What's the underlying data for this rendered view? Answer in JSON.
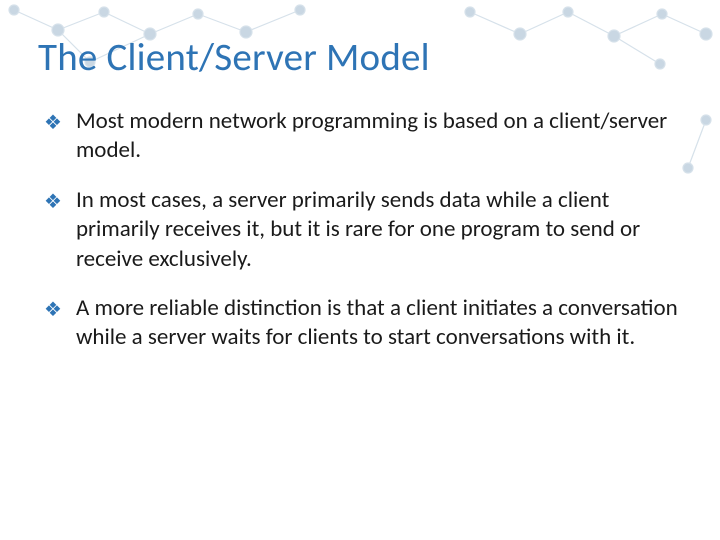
{
  "title": "The Client/Server Model",
  "bullets": [
    "Most modern network programming is based on a client/server model.",
    "In most cases, a server primarily sends data while a client primarily receives it, but it is rare for one program to send or receive exclusively.",
    "A more reliable distinction is that a client initiates a conversation while a server waits for clients to start conversations with it."
  ]
}
